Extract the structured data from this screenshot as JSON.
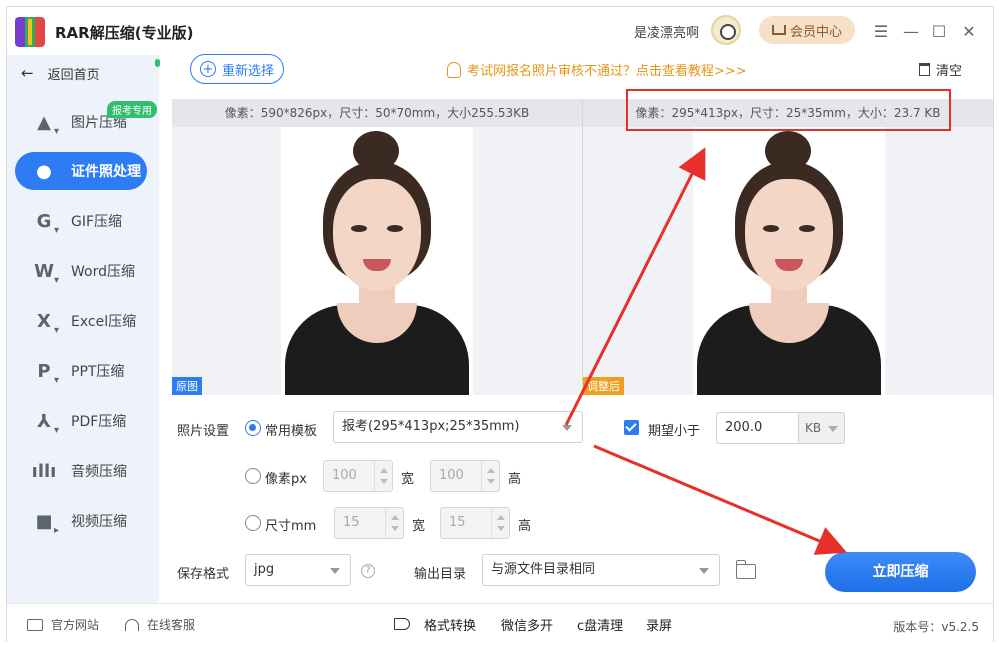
{
  "app": {
    "title": "RAR解压缩(专业版)",
    "user_name": "是凌漂亮啊",
    "vip_label": "会员中心"
  },
  "window_controls": {
    "menu": "☰",
    "minimize": "—",
    "maximize": "☐",
    "close": "✕"
  },
  "sidebar": {
    "back_label": "返回首页",
    "exam_badge": "报考专用",
    "items": [
      {
        "label": "图片压缩",
        "icon": "image-icon"
      },
      {
        "label": "证件照处理",
        "icon": "id-photo-icon",
        "active": true
      },
      {
        "label": "GIF压缩",
        "icon": "gif-icon"
      },
      {
        "label": "Word压缩",
        "icon": "word-icon"
      },
      {
        "label": "Excel压缩",
        "icon": "excel-icon"
      },
      {
        "label": "PPT压缩",
        "icon": "ppt-icon"
      },
      {
        "label": "PDF压缩",
        "icon": "pdf-icon"
      },
      {
        "label": "音频压缩",
        "icon": "audio-icon"
      },
      {
        "label": "视频压缩",
        "icon": "video-icon"
      }
    ]
  },
  "toolbar": {
    "reselect_label": "重新选择",
    "tip_text": "考试网报名照片审核不通过？点击查看教程>>>",
    "clear_label": "清空"
  },
  "preview": {
    "original_info": "像素：590*826px，尺寸：50*70mm，大小255.53KB",
    "original_tag": "原图",
    "adjusted_info": "像素：295*413px，尺寸：25*35mm，大小：23.7 KB",
    "adjusted_tag": "调整后"
  },
  "settings": {
    "photo_settings_label": "照片设置",
    "template_radio_label": "常用模板",
    "template_value": "报考(295*413px;25*35mm)",
    "expect_label": "期望小于",
    "expect_value": "200.0",
    "expect_unit": "KB",
    "pixel_radio_label": "像素px",
    "pixel_width": "100",
    "pixel_width_label": "宽",
    "pixel_height": "100",
    "pixel_height_label": "高",
    "size_radio_label": "尺寸mm",
    "size_width": "15",
    "size_width_label": "宽",
    "size_height": "15",
    "size_height_label": "高",
    "save_format_label": "保存格式",
    "save_format_value": "jpg",
    "help_glyph": "?",
    "output_dir_label": "输出目录",
    "output_dir_value": "与源文件目录相同",
    "compress_button": "立即压缩"
  },
  "footer": {
    "website": "官方网站",
    "service": "在线客服",
    "format_convert": "格式转换",
    "wechat_multi": "微信多开",
    "c_clean": "c盘清理",
    "record": "录屏",
    "version": "版本号：v5.2.5"
  },
  "colors": {
    "accent": "#2d7cf4",
    "highlight_red": "#e8302a",
    "tip_orange": "#e6951a",
    "badge_green": "#2fbf6f"
  }
}
